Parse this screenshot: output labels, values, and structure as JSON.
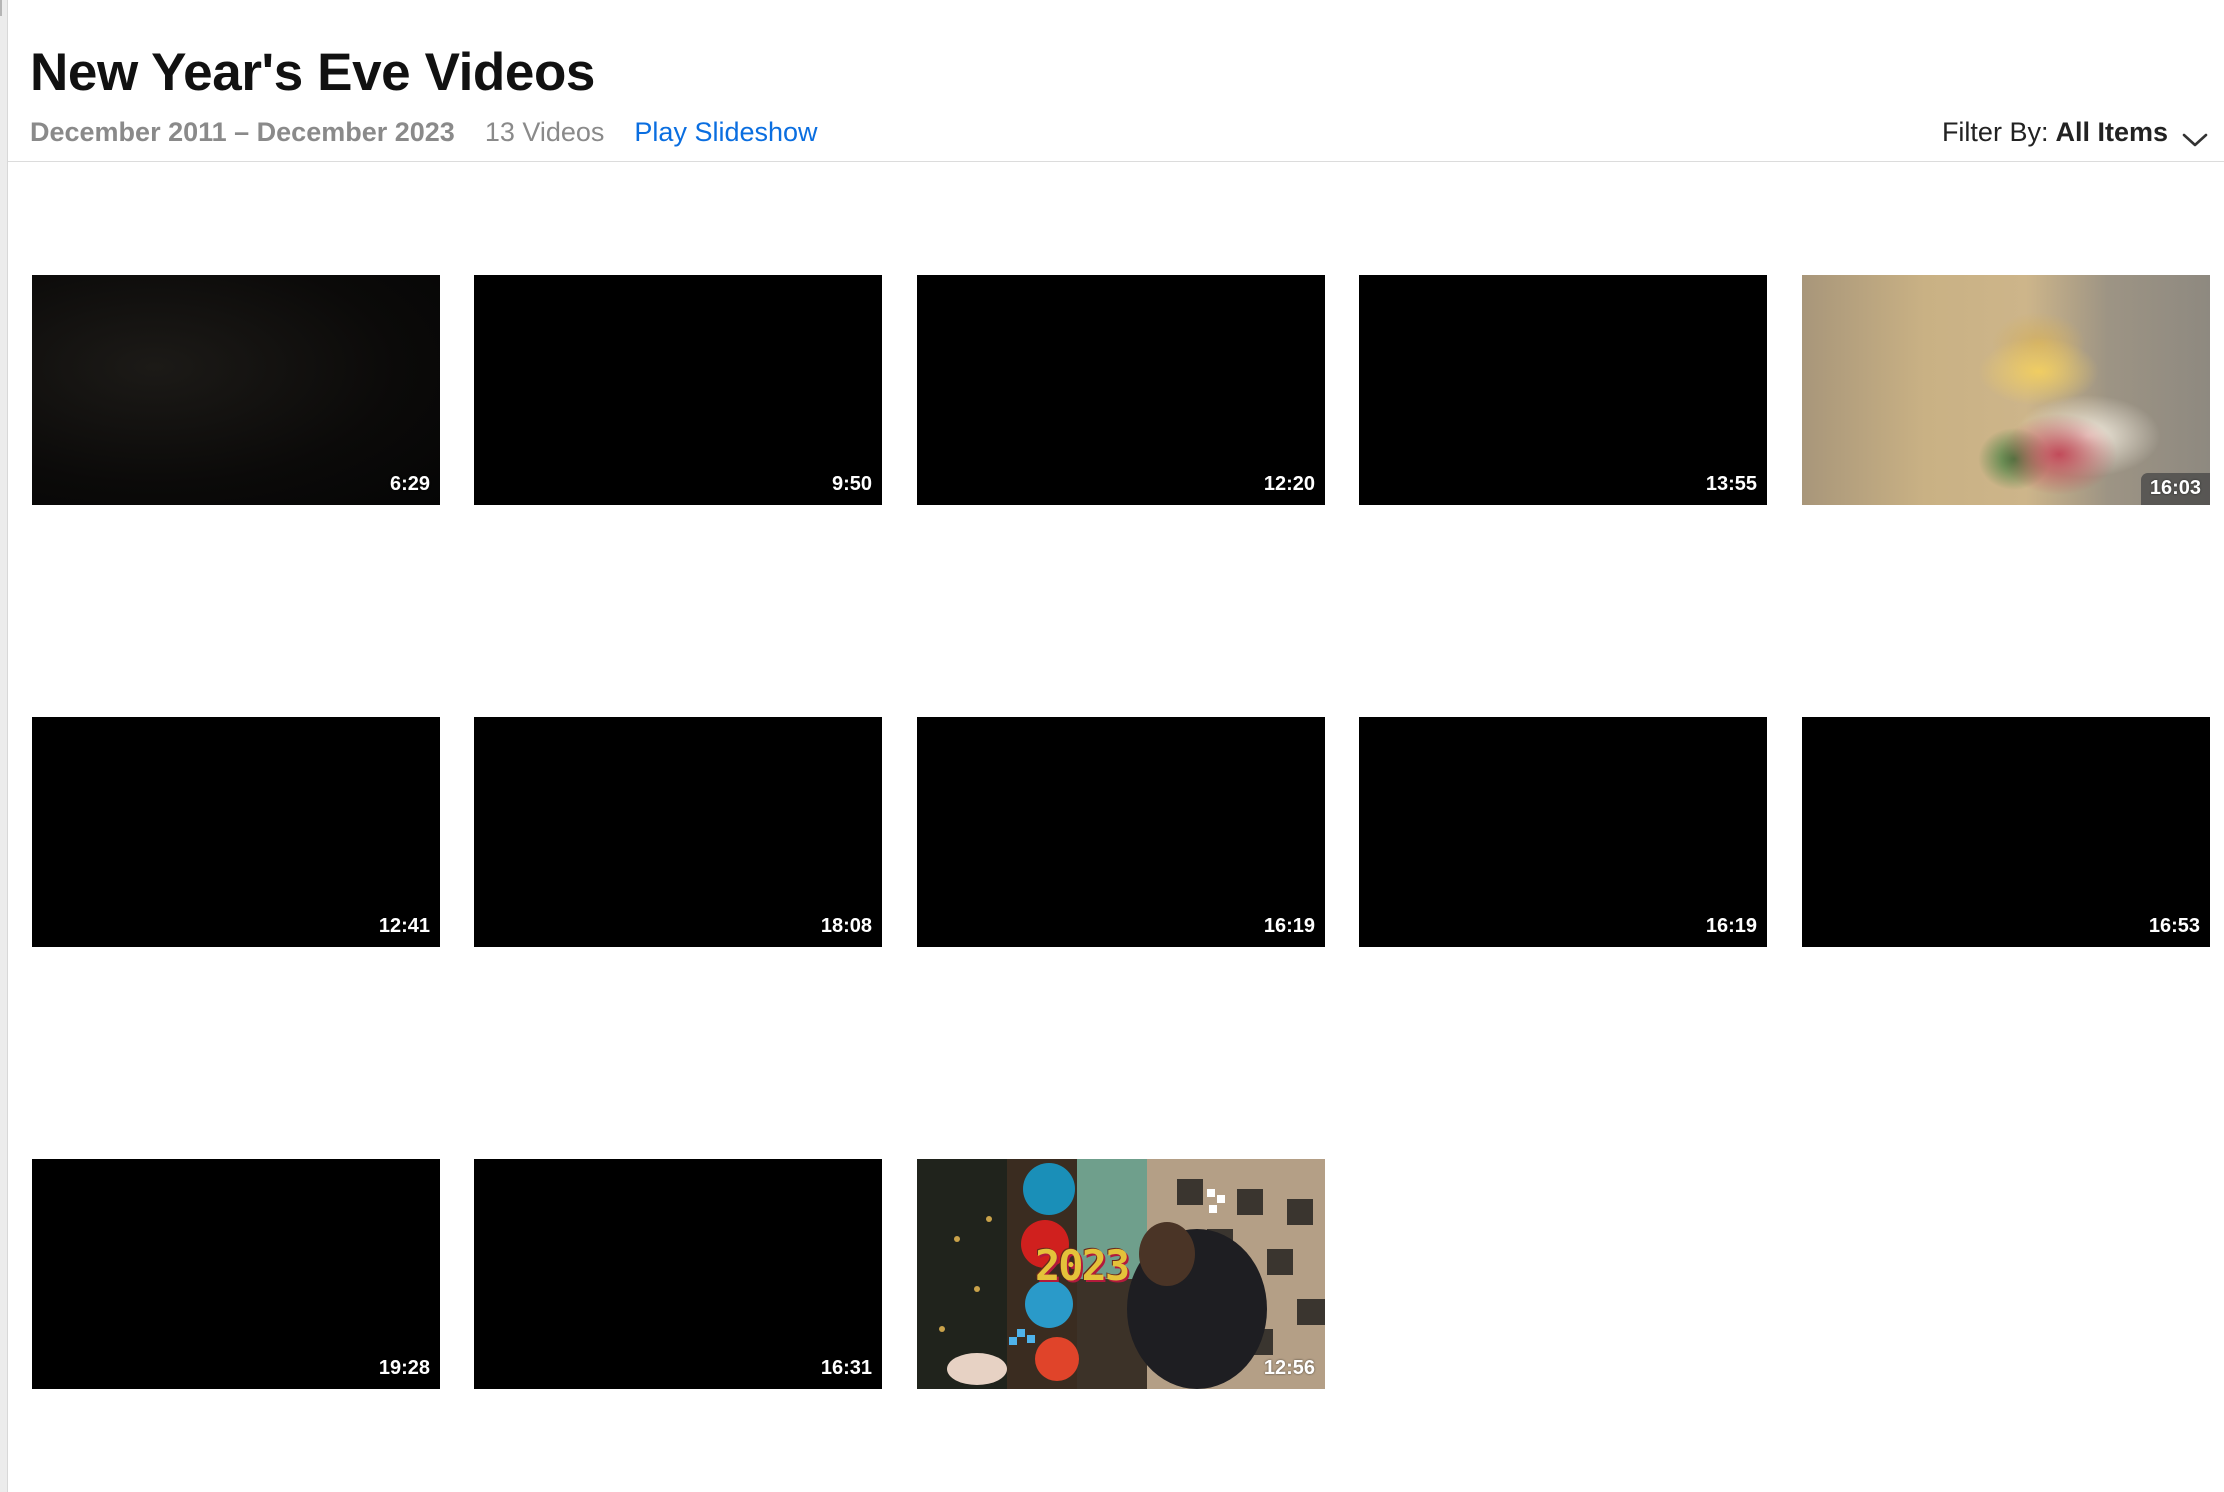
{
  "header": {
    "title": "New Year's Eve Videos",
    "date_range": "December 2011 – December 2023",
    "video_count": "13 Videos",
    "play_slideshow": "Play Slideshow",
    "filter_label": "Filter By:",
    "filter_value": "All Items"
  },
  "videos": [
    {
      "duration": "6:29",
      "thumbnail": "dark-scene"
    },
    {
      "duration": "9:50",
      "thumbnail": "black"
    },
    {
      "duration": "12:20",
      "thumbnail": "black"
    },
    {
      "duration": "13:55",
      "thumbnail": "black"
    },
    {
      "duration": "16:03",
      "thumbnail": "child-blurred"
    },
    {
      "duration": "12:41",
      "thumbnail": "black"
    },
    {
      "duration": "18:08",
      "thumbnail": "black"
    },
    {
      "duration": "16:19",
      "thumbnail": "black"
    },
    {
      "duration": "16:19",
      "thumbnail": "black"
    },
    {
      "duration": "16:53",
      "thumbnail": "black"
    },
    {
      "duration": "19:28",
      "thumbnail": "black"
    },
    {
      "duration": "16:31",
      "thumbnail": "black"
    },
    {
      "duration": "12:56",
      "thumbnail": "party-2023"
    }
  ],
  "thumbnail_overlay": {
    "year_text": "2023"
  },
  "colors": {
    "accent": "#0a6ee0",
    "secondary_text": "#8a8a8a"
  }
}
